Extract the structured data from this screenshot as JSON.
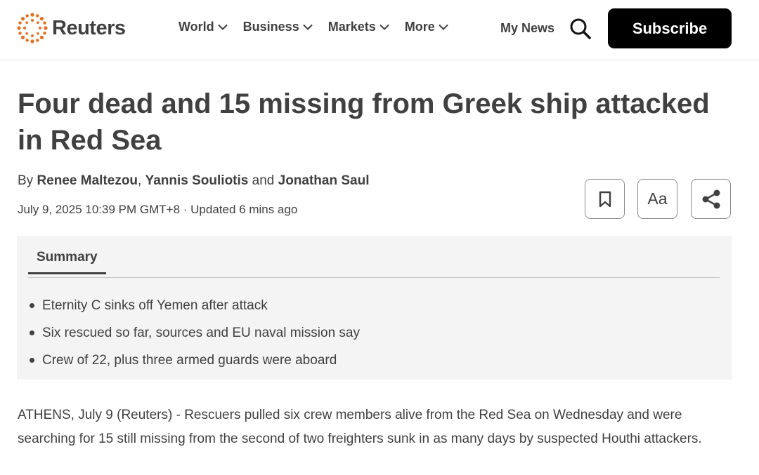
{
  "header": {
    "brand": "Reuters",
    "nav": [
      {
        "label": "World"
      },
      {
        "label": "Business"
      },
      {
        "label": "Markets"
      },
      {
        "label": "More"
      }
    ],
    "my_news": "My News",
    "subscribe": "Subscribe",
    "icons": {
      "logo": "reuters-dots-logo",
      "search": "search-icon",
      "chevron": "chevron-down-icon"
    }
  },
  "article": {
    "headline": "Four dead and 15 missing from Greek ship attacked in Red Sea",
    "byline": {
      "prefix": "By ",
      "author1": "Renee Maltezou",
      "sep1": ", ",
      "author2": "Yannis Souliotis",
      "sep2": " and ",
      "author3": "Jonathan Saul"
    },
    "dateline": "July 9, 2025 10:39 PM GMT+8 · Updated 6 mins ago",
    "tools": {
      "font_label": "Aa",
      "icons": [
        "bookmark-icon",
        "font-size-icon",
        "share-icon"
      ]
    },
    "summary": {
      "tab_label": "Summary",
      "items": [
        "Eternity C sinks off Yemen after attack",
        "Six rescued so far, sources and EU naval mission say",
        "Crew of 22, plus three armed guards were aboard"
      ]
    },
    "body": "ATHENS, July 9 (Reuters) - Rescuers pulled six crew members alive from the Red Sea on Wednesday and were searching for 15 still missing from the second of two freighters sunk in as many days by suspected Houthi attackers."
  },
  "colors": {
    "brand_orange": "#e56e1e",
    "text": "#404040",
    "subscribe_bg": "#000000",
    "summary_bg": "#f4f4f4"
  }
}
